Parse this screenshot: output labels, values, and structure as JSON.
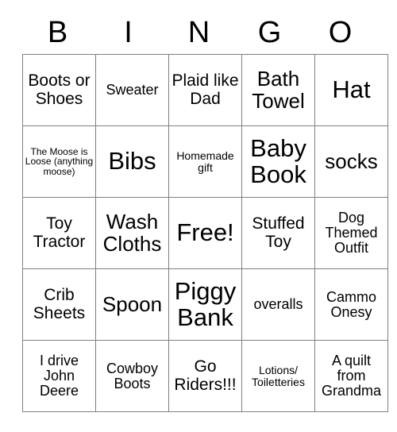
{
  "card": {
    "type": "bingo-card",
    "columns": 5,
    "rows": 5,
    "header": {
      "letters": [
        "B",
        "I",
        "N",
        "G",
        "O"
      ]
    },
    "colors": {
      "text": "#000000",
      "border": "#808080",
      "background": "#ffffff"
    },
    "cells": [
      [
        {
          "text": "Boots or Shoes",
          "size": "fs-l"
        },
        {
          "text": "Sweater",
          "size": "fs-m"
        },
        {
          "text": "Plaid like Dad",
          "size": "fs-l"
        },
        {
          "text": "Bath Towel",
          "size": "fs-xl"
        },
        {
          "text": "Hat",
          "size": "fs-xxl"
        }
      ],
      [
        {
          "text": "The Moose is Loose (anything moose)",
          "size": "fs-xs"
        },
        {
          "text": "Bibs",
          "size": "fs-xxl"
        },
        {
          "text": "Homemade gift",
          "size": "fs-s"
        },
        {
          "text": "Baby Book",
          "size": "fs-xxl"
        },
        {
          "text": "socks",
          "size": "fs-xl"
        }
      ],
      [
        {
          "text": "Toy Tractor",
          "size": "fs-l"
        },
        {
          "text": "Wash Cloths",
          "size": "fs-xl"
        },
        {
          "text": "Free!",
          "size": "fs-xxl"
        },
        {
          "text": "Stuffed Toy",
          "size": "fs-l"
        },
        {
          "text": "Dog Themed Outfit",
          "size": "fs-m"
        }
      ],
      [
        {
          "text": "Crib Sheets",
          "size": "fs-l"
        },
        {
          "text": "Spoon",
          "size": "fs-xl"
        },
        {
          "text": "Piggy Bank",
          "size": "fs-xxl"
        },
        {
          "text": "overalls",
          "size": "fs-m"
        },
        {
          "text": "Cammo Onesy",
          "size": "fs-m"
        }
      ],
      [
        {
          "text": "I drive John Deere",
          "size": "fs-m"
        },
        {
          "text": "Cowboy Boots",
          "size": "fs-m"
        },
        {
          "text": "Go Riders!!!",
          "size": "fs-l"
        },
        {
          "text": "Lotions/ Toiletteries",
          "size": "fs-s"
        },
        {
          "text": "A quilt from Grandma",
          "size": "fs-m"
        }
      ]
    ]
  }
}
